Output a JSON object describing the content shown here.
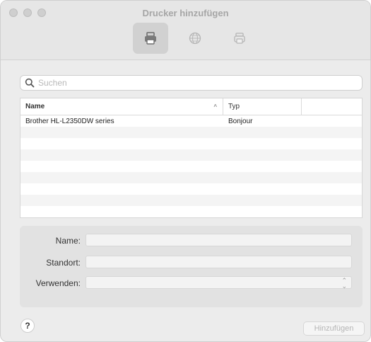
{
  "window": {
    "title": "Drucker hinzufügen"
  },
  "toolbar": {
    "tabs": [
      {
        "icon": "printer-default-icon",
        "active": true
      },
      {
        "icon": "globe-ip-icon",
        "active": false
      },
      {
        "icon": "windows-printer-icon",
        "active": false
      }
    ]
  },
  "search": {
    "placeholder": "Suchen",
    "value": ""
  },
  "table": {
    "columns": [
      "Name",
      "Typ"
    ],
    "rows": [
      {
        "name": "Brother HL-L2350DW series",
        "type": "Bonjour"
      }
    ]
  },
  "details": {
    "name_label": "Name:",
    "location_label": "Standort:",
    "use_label": "Verwenden:"
  },
  "footer": {
    "help_label": "?",
    "add_label": "Hinzufügen"
  }
}
